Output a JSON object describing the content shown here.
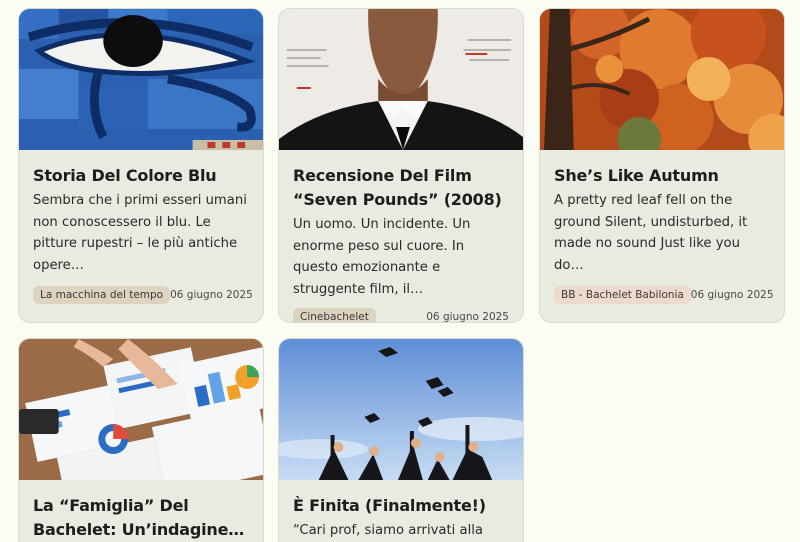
{
  "cards": [
    {
      "title": "Storia Del Colore Blu",
      "excerpt": "Sembra che i primi esseri umani non conoscessero il blu. Le pitture rupestri – le più antiche opere…",
      "tag": "La macchina del tempo",
      "date": "06 giugno 2025",
      "image": "eye-of-horus-mosaic"
    },
    {
      "title": "Recensione Del Film “Seven Pounds” (2008)",
      "excerpt": "Un uomo. Un incidente. Un enorme peso sul cuore.  In questo emozionante e struggente film, il…",
      "tag": "Cinebachelet",
      "date": "06 giugno 2025",
      "image": "man-in-suit-poster"
    },
    {
      "title": "She’s Like Autumn",
      "excerpt": "A pretty red leaf fell on the ground  Silent, undisturbed, it made no sound  Just like you do…",
      "tag": "BB - Bachelet Babilonia",
      "date": "06 giugno 2025",
      "image": "autumn-tree"
    },
    {
      "title": "La “Famiglia” Del Bachelet: Un’indagine…",
      "excerpt": "",
      "image": "charts-on-table"
    },
    {
      "title": "È Finita (Finalmente!)",
      "excerpt": "“Cari prof, siamo arrivati alla fine!”",
      "image": "graduation-caps"
    }
  ]
}
